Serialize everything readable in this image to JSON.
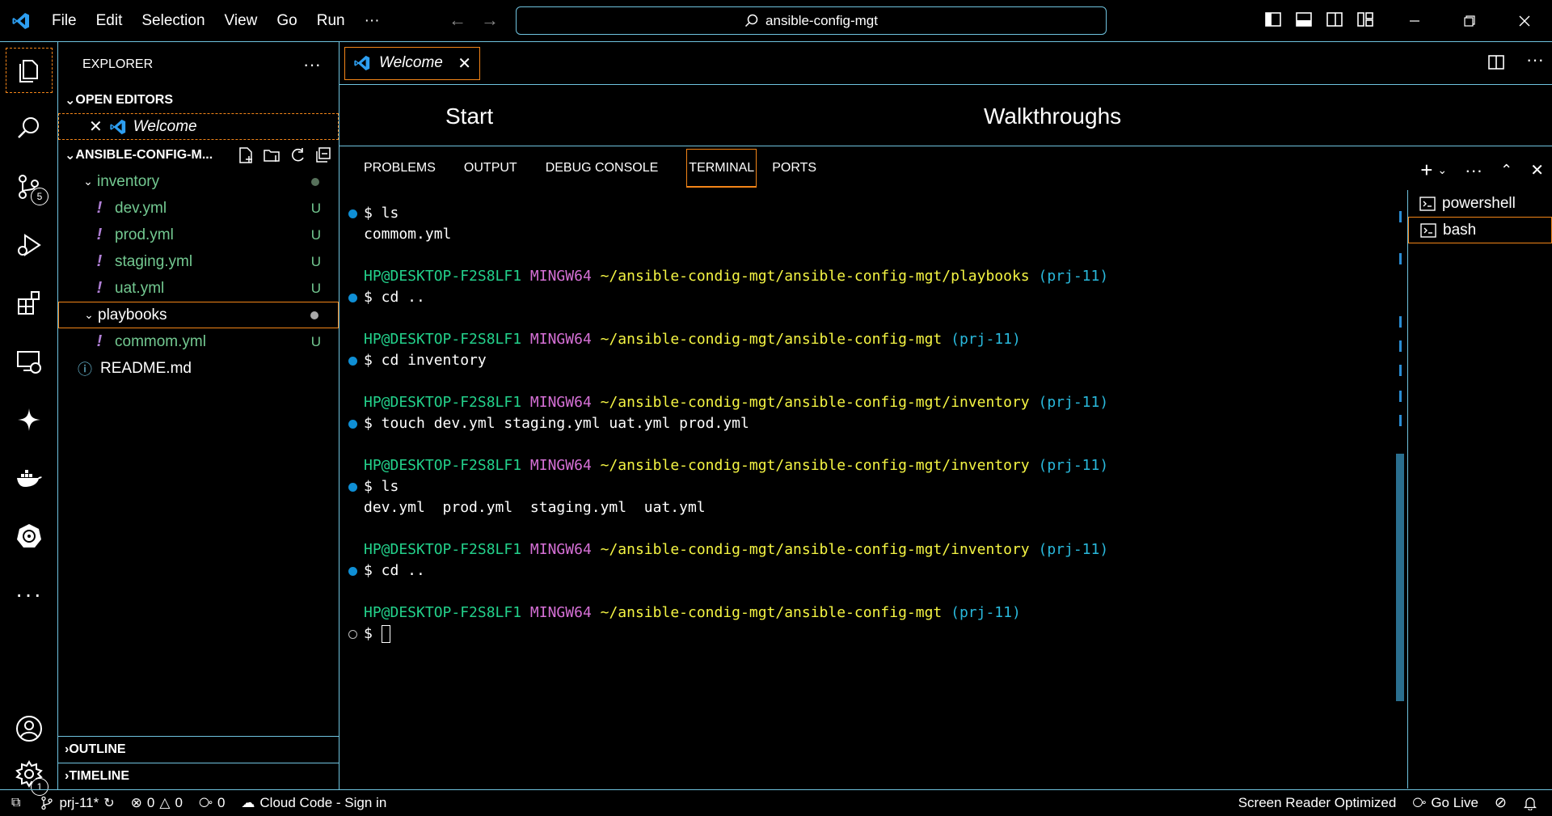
{
  "titlebar": {
    "menu": [
      "File",
      "Edit",
      "Selection",
      "View",
      "Go",
      "Run",
      "···"
    ],
    "search": "ansible-config-mgt"
  },
  "activitybar": {
    "source_control_badge": "5",
    "settings_badge": "1"
  },
  "sidebar": {
    "title": "EXPLORER",
    "open_editors_label": "OPEN EDITORS",
    "open_editor_item": "Welcome",
    "workspace_label": "ANSIBLE-CONFIG-M...",
    "tree": {
      "inventory": "inventory",
      "dev": "dev.yml",
      "prod": "prod.yml",
      "staging": "staging.yml",
      "uat": "uat.yml",
      "playbooks": "playbooks",
      "commom": "commom.yml",
      "readme": "README.md"
    },
    "untracked_marker": "U",
    "outline_label": "OUTLINE",
    "timeline_label": "TIMELINE"
  },
  "editor": {
    "tab_label": "Welcome",
    "welcome_start": "Start",
    "welcome_walkthroughs": "Walkthroughs"
  },
  "panel": {
    "tabs": [
      "PROBLEMS",
      "OUTPUT",
      "DEBUG CONSOLE",
      "TERMINAL",
      "PORTS"
    ],
    "terminals": [
      "powershell",
      "bash"
    ]
  },
  "terminal": {
    "user": "HP@DESKTOP-F2S8LF1",
    "env": "MINGW64",
    "branch": "(prj-11)",
    "path_playbooks": "~/ansible-condig-mgt/ansible-config-mgt/playbooks",
    "path_root": "~/ansible-condig-mgt/ansible-config-mgt",
    "path_inventory": "~/ansible-condig-mgt/ansible-config-mgt/inventory",
    "cmd1": "$ ls",
    "out1": "commom.yml",
    "cmd2": "$ cd ..",
    "cmd3": "$ cd inventory",
    "cmd4": "$ touch dev.yml staging.yml uat.yml prod.yml",
    "cmd5": "$ ls",
    "out5": "dev.yml  prod.yml  staging.yml  uat.yml",
    "cmd6": "$ cd ..",
    "prompt": "$ "
  },
  "statusbar": {
    "branch": "prj-11*",
    "errors": "0",
    "warnings": "0",
    "ports": "0",
    "cloud_code": "Cloud Code - Sign in",
    "screen_reader": "Screen Reader Optimized",
    "go_live": "Go Live"
  },
  "colors": {
    "border": "#6fc3df",
    "focus": "#f38518",
    "git_untracked": "#73c991",
    "prompt_user": "#23d18b",
    "prompt_env": "#d670d6",
    "prompt_path": "#f5f543",
    "prompt_branch": "#29b8db"
  }
}
